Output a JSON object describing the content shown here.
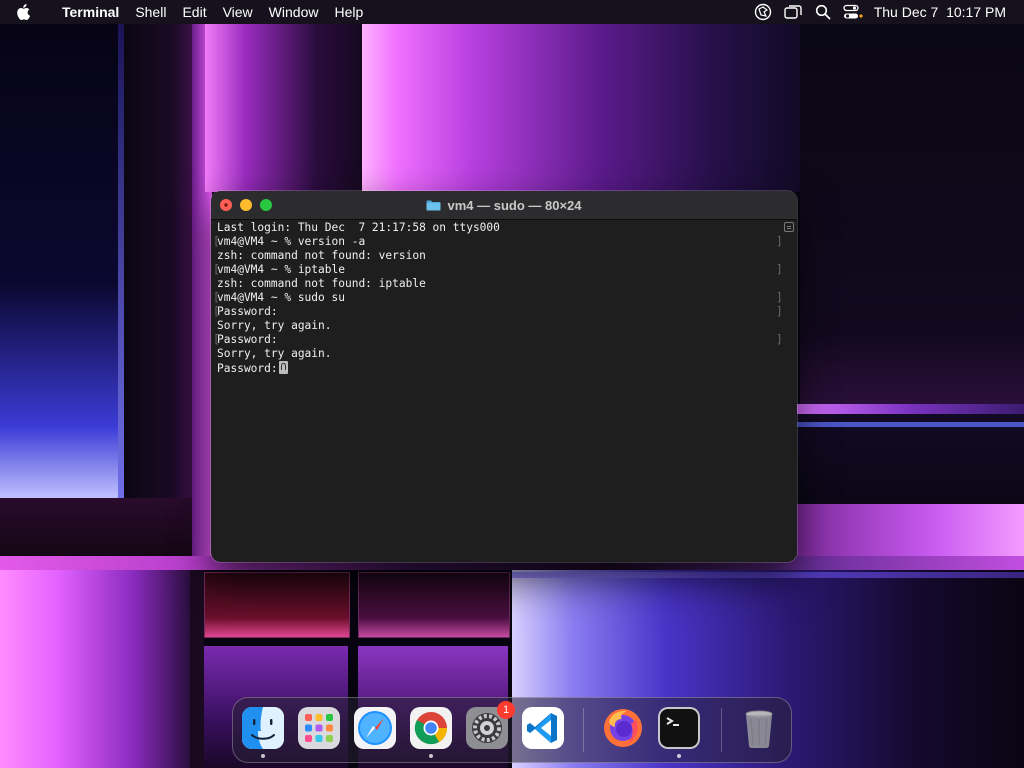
{
  "menubar": {
    "apple_icon": "apple-icon",
    "app_name": "Terminal",
    "menus": [
      "Shell",
      "Edit",
      "View",
      "Window",
      "Help"
    ],
    "status_icons": [
      "vpn-icon",
      "screen-mirroring-icon",
      "search-icon",
      "control-center-icon"
    ],
    "clock": "Thu Dec 7  10:17 PM"
  },
  "terminal": {
    "title": "vm4 — sudo — 80×24",
    "folder_icon": "folder-icon",
    "lines": [
      "Last login: Thu Dec  7 21:17:58 on ttys000",
      "vm4@VM4 ~ % version -a",
      "zsh: command not found: version",
      "vm4@VM4 ~ % iptable",
      "zsh: command not found: iptable",
      "vm4@VM4 ~ % sudo su",
      "Password:",
      "Sorry, try again.",
      "Password:",
      "Sorry, try again.",
      "Password:"
    ]
  },
  "dock": {
    "apps": [
      {
        "name": "Finder",
        "icon": "finder-icon",
        "running": true
      },
      {
        "name": "Launchpad",
        "icon": "launchpad-icon",
        "running": false
      },
      {
        "name": "Safari",
        "icon": "safari-icon",
        "running": false
      },
      {
        "name": "Google Chrome",
        "icon": "chrome-icon",
        "running": true
      },
      {
        "name": "System Settings",
        "icon": "settings-icon",
        "running": false,
        "badge": "1"
      },
      {
        "name": "Visual Studio Code",
        "icon": "vscode-icon",
        "running": false
      },
      {
        "name": "Firefox",
        "icon": "firefox-icon",
        "running": false
      },
      {
        "name": "Terminal",
        "icon": "terminal-icon",
        "running": true
      },
      {
        "name": "Trash",
        "icon": "trash-icon",
        "running": false
      }
    ]
  },
  "colors": {
    "menubar_bg": "#18141e",
    "terminal_bg": "#1e1e1e",
    "close": "#ff5f57",
    "minimize": "#febc2e",
    "maximize": "#28c840",
    "badge": "#ff3b30"
  }
}
